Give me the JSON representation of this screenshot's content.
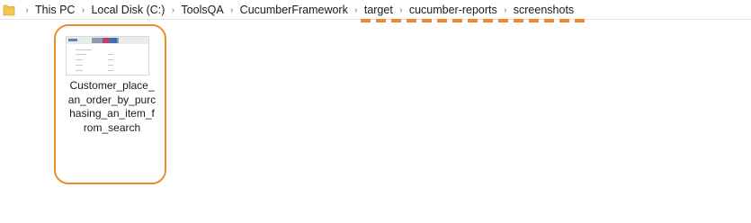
{
  "address_bar": {
    "path": [
      "This PC",
      "Local Disk (C:)",
      "ToolsQA",
      "CucumberFramework",
      "target",
      "cucumber-reports",
      "screenshots"
    ],
    "separator": "›"
  },
  "file": {
    "name_lines": [
      "Customer_place_",
      "an_order_by_purc",
      "hasing_an_item_f",
      "rom_search"
    ]
  },
  "colors": {
    "highlight": "#ef8a2b",
    "folder": "#f3c755"
  },
  "icons": {
    "folder": "folder-icon",
    "separator": "chevron-right-icon"
  }
}
